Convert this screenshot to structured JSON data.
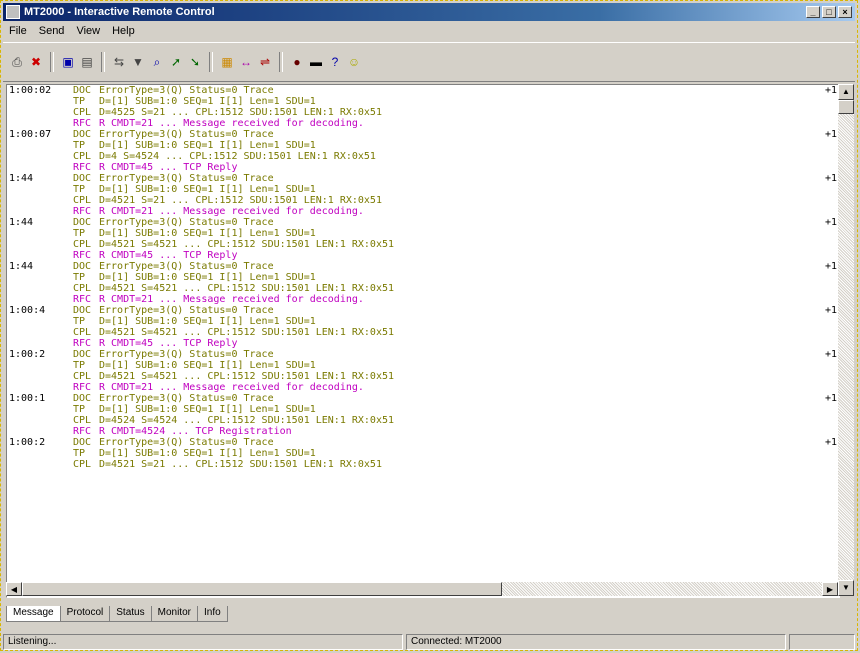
{
  "window": {
    "title": "MT2000 - Interactive Remote Control",
    "buttons": [
      "_",
      "□",
      "×"
    ]
  },
  "menu": [
    "File",
    "Send",
    "View",
    "Help"
  ],
  "toolbar": {
    "icons": [
      "print-icon",
      "clear-icon",
      "save-icon",
      "open-icon",
      "connect-icon",
      "filter-icon",
      "find-icon",
      "send-icon",
      "receive-icon",
      "trace-icon",
      "stop-icon",
      "options-icon",
      "record-icon",
      "zoom-icon",
      "help-icon",
      "about-icon"
    ]
  },
  "log": {
    "rows": [
      {
        "time": "1:00:02",
        "type": "DOC",
        "msg": "ErrorType=3(Q)  Status=0 Trace",
        "code": "+1"
      },
      {
        "time": "",
        "type": "TP",
        "msg": "D=[1]  SUB=1:0  SEQ=1  I[1]  Len=1  SDU=1",
        "code": ""
      },
      {
        "time": "",
        "type": "CPL",
        "msg": "D=4525 S=21  ...  CPL:1512  SDU:1501  LEN:1  RX:0x51",
        "code": ""
      },
      {
        "time": "",
        "type": "RFC",
        "msg": "R CMDT=21  ...  Message received for decoding.",
        "code": ""
      },
      {
        "time": "1:00:07",
        "type": "DOC",
        "msg": "ErrorType=3(Q)  Status=0 Trace",
        "code": "+1"
      },
      {
        "time": "",
        "type": "TP",
        "msg": "D=[1]  SUB=1:0  SEQ=1  I[1]  Len=1  SDU=1",
        "code": ""
      },
      {
        "time": "",
        "type": "CPL",
        "msg": "D=4 S=4524  ...  CPL:1512  SDU:1501  LEN:1  RX:0x51",
        "code": ""
      },
      {
        "time": "",
        "type": "RFC",
        "msg": "R CMDT=45  ...  TCP Reply",
        "code": ""
      },
      {
        "time": "1:44",
        "type": "DOC",
        "msg": "ErrorType=3(Q)  Status=0 Trace",
        "code": "+1"
      },
      {
        "time": "",
        "type": "TP",
        "msg": "D=[1]  SUB=1:0  SEQ=1  I[1]  Len=1  SDU=1",
        "code": ""
      },
      {
        "time": "",
        "type": "CPL",
        "msg": "D=4521 S=21  ...  CPL:1512  SDU:1501  LEN:1  RX:0x51",
        "code": ""
      },
      {
        "time": "",
        "type": "RFC",
        "msg": "R CMDT=21  ...  Message received for decoding.",
        "code": ""
      },
      {
        "time": "1:44",
        "type": "DOC",
        "msg": "ErrorType=3(Q)  Status=0 Trace",
        "code": "+1"
      },
      {
        "time": "",
        "type": "TP",
        "msg": "D=[1]  SUB=1:0  SEQ=1  I[1]  Len=1  SDU=1",
        "code": ""
      },
      {
        "time": "",
        "type": "CPL",
        "msg": "D=4521 S=4521  ...  CPL:1512  SDU:1501  LEN:1  RX:0x51",
        "code": ""
      },
      {
        "time": "",
        "type": "RFC",
        "msg": "R CMDT=45  ...  TCP Reply",
        "code": ""
      },
      {
        "time": "1:44",
        "type": "DOC",
        "msg": "ErrorType=3(Q)  Status=0 Trace",
        "code": "+1"
      },
      {
        "time": "",
        "type": "TP",
        "msg": "D=[1]  SUB=1:0  SEQ=1  I[1]  Len=1  SDU=1",
        "code": ""
      },
      {
        "time": "",
        "type": "CPL",
        "msg": "D=4521 S=4521  ...  CPL:1512  SDU:1501  LEN:1  RX:0x51",
        "code": ""
      },
      {
        "time": "",
        "type": "RFC",
        "msg": "R CMDT=21  ...  Message received for decoding.",
        "code": ""
      },
      {
        "time": "1:00:4",
        "type": "DOC",
        "msg": "ErrorType=3(Q)  Status=0 Trace",
        "code": "+1"
      },
      {
        "time": "",
        "type": "TP",
        "msg": "D=[1]  SUB=1:0  SEQ=1  I[1]  Len=1  SDU=1",
        "code": ""
      },
      {
        "time": "",
        "type": "CPL",
        "msg": "D=4521 S=4521  ...  CPL:1512  SDU:1501  LEN:1  RX:0x51",
        "code": ""
      },
      {
        "time": "",
        "type": "RFC",
        "msg": "R CMDT=45  ...  TCP Reply",
        "code": ""
      },
      {
        "time": "1:00:2",
        "type": "DOC",
        "msg": "ErrorType=3(Q)  Status=0 Trace",
        "code": "+1"
      },
      {
        "time": "",
        "type": "TP",
        "msg": "D=[1]  SUB=1:0  SEQ=1  I[1]  Len=1  SDU=1",
        "code": ""
      },
      {
        "time": "",
        "type": "CPL",
        "msg": "D=4521 S=4521  ...  CPL:1512  SDU:1501  LEN:1  RX:0x51",
        "code": ""
      },
      {
        "time": "",
        "type": "RFC",
        "msg": "R CMDT=21  ...  Message received for decoding.",
        "code": ""
      },
      {
        "time": "1:00:1",
        "type": "DOC",
        "msg": "ErrorType=3(Q)  Status=0 Trace",
        "code": "+1"
      },
      {
        "time": "",
        "type": "TP",
        "msg": "D=[1]  SUB=1:0  SEQ=1  I[1]  Len=1  SDU=1",
        "code": ""
      },
      {
        "time": "",
        "type": "CPL",
        "msg": "D=4524 S=4524  ...  CPL:1512  SDU:1501  LEN:1  RX:0x51",
        "code": ""
      },
      {
        "time": "",
        "type": "RFC",
        "msg": "R CMDT=4524  ...  TCP Registration",
        "code": ""
      },
      {
        "time": "1:00:2",
        "type": "DOC",
        "msg": "ErrorType=3(Q)  Status=0 Trace",
        "code": "+1"
      },
      {
        "time": "",
        "type": "TP",
        "msg": "D=[1]  SUB=1:0  SEQ=1  I[1]  Len=1  SDU=1",
        "code": ""
      },
      {
        "time": "",
        "type": "CPL",
        "msg": "D=4521 S=21  ...  CPL:1512  SDU:1501  LEN:1  RX:0x51",
        "code": ""
      }
    ]
  },
  "tabs": [
    "Message",
    "Protocol",
    "Status",
    "Monitor",
    "Info"
  ],
  "status": {
    "left": "Listening...",
    "middle": "Connected: MT2000",
    "right": ""
  }
}
